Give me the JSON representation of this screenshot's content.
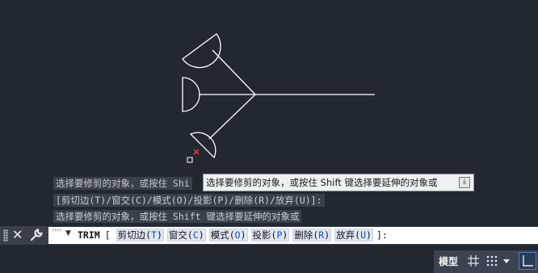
{
  "history": {
    "line1": "选择要修剪的对象，或按住 Shi",
    "line2": "[剪切边(T)/窗交(C)/模式(O)/投影(P)/删除(R)/放弃(U)]:",
    "line3": "选择要修剪的对象，或按住 Shift 键选择要延伸的对象或"
  },
  "tooltip": {
    "text": "选择要修剪的对象，或按住 Shift 键选择要延伸的对象或"
  },
  "command_line": {
    "command": "TRIM",
    "open_bracket": "[",
    "options": [
      {
        "label": "剪切边(",
        "key": "T",
        "close": ")"
      },
      {
        "label": "窗交(",
        "key": "C",
        "close": ")"
      },
      {
        "label": "模式(",
        "key": "O",
        "close": ")"
      },
      {
        "label": "投影(",
        "key": "P",
        "close": ")"
      },
      {
        "label": "删除(",
        "key": "R",
        "close": ")"
      },
      {
        "label": "放弃(",
        "key": "U",
        "close": ")"
      }
    ],
    "close_bracket": "]:"
  },
  "status_bar": {
    "model_tab": "模型",
    "icons": [
      "grid-icon",
      "snap-icon",
      "dropdown-icon",
      "ortho-icon"
    ]
  },
  "colors": {
    "canvas_bg": "#212830",
    "geometry": "#ffffff",
    "cursor": "#e0343c",
    "option_key": "#1c46c6"
  }
}
